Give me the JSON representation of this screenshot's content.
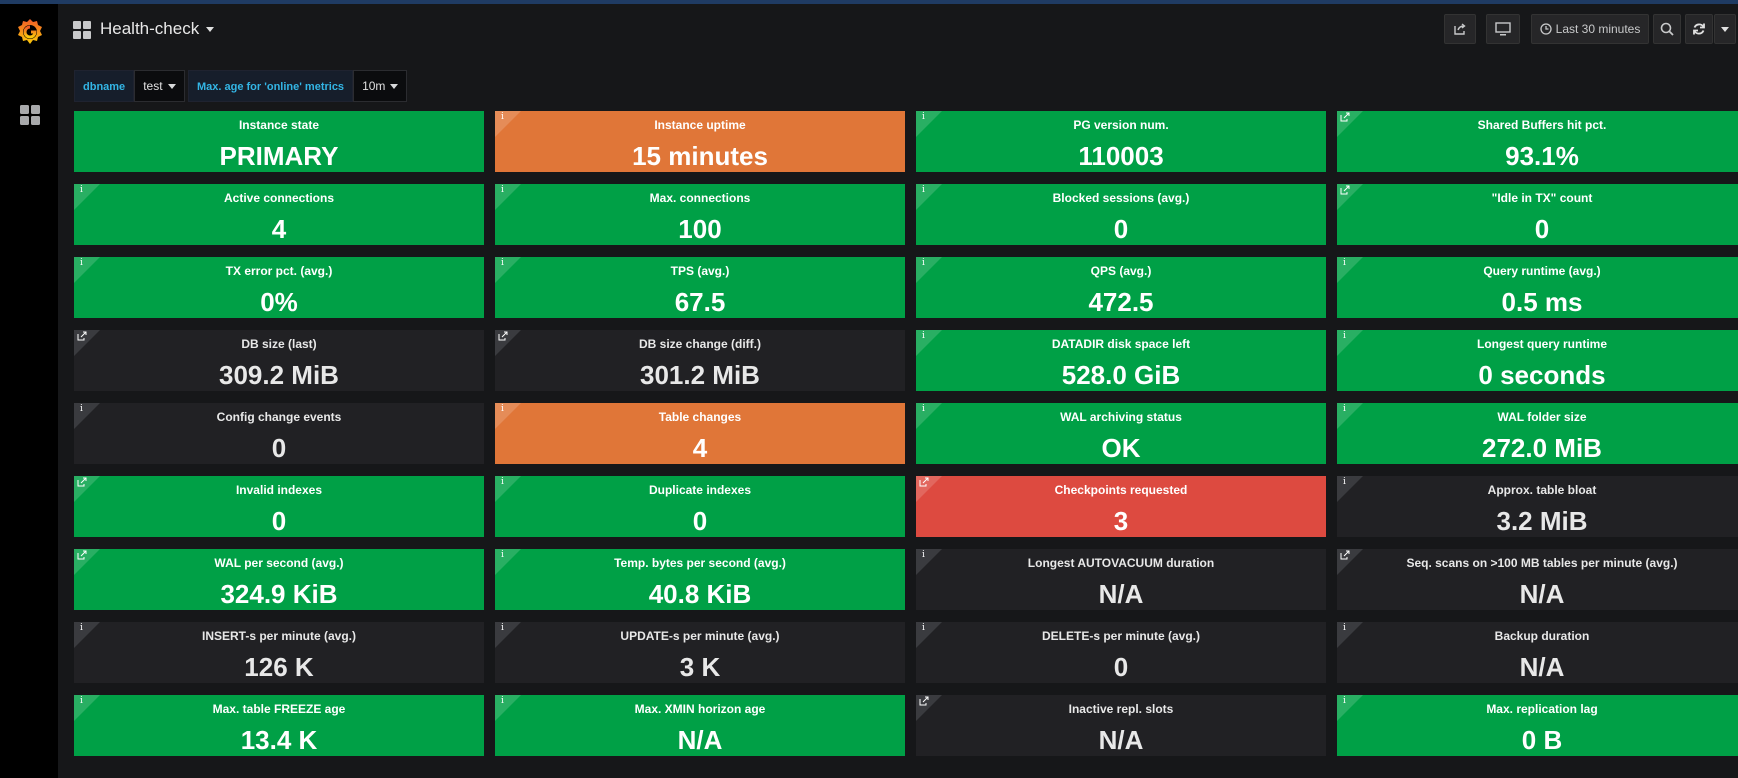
{
  "navbar": {
    "title": "Health-check",
    "time_range": "Last 30 minutes"
  },
  "variables": [
    {
      "label": "dbname",
      "value": "test"
    },
    {
      "label": "Max. age for 'online' metrics",
      "value": "10m"
    }
  ],
  "colors": {
    "ok": "#00a046",
    "warning": "#e07638",
    "critical": "#dd4a40",
    "neutral": "#212124"
  },
  "panels": [
    {
      "title": "Instance state",
      "value": "PRIMARY",
      "status": "green",
      "icon": "none"
    },
    {
      "title": "Instance uptime",
      "value": "15 minutes",
      "status": "orange",
      "icon": "info-icon"
    },
    {
      "title": "PG version num.",
      "value": "110003",
      "status": "green",
      "icon": "info-icon"
    },
    {
      "title": "Shared Buffers hit pct.",
      "value": "93.1%",
      "status": "green",
      "icon": "external-link-icon"
    },
    {
      "title": "Active connections",
      "value": "4",
      "status": "green",
      "icon": "info-icon"
    },
    {
      "title": "Max. connections",
      "value": "100",
      "status": "green",
      "icon": "info-icon"
    },
    {
      "title": "Blocked sessions (avg.)",
      "value": "0",
      "status": "green",
      "icon": "info-icon"
    },
    {
      "title": "\"Idle in TX\" count",
      "value": "0",
      "status": "green",
      "icon": "external-link-icon"
    },
    {
      "title": "TX error pct. (avg.)",
      "value": "0%",
      "status": "green",
      "icon": "info-icon"
    },
    {
      "title": "TPS (avg.)",
      "value": "67.5",
      "status": "green",
      "icon": "info-icon"
    },
    {
      "title": "QPS (avg.)",
      "value": "472.5",
      "status": "green",
      "icon": "info-icon"
    },
    {
      "title": "Query runtime (avg.)",
      "value": "0.5 ms",
      "status": "green",
      "icon": "info-icon"
    },
    {
      "title": "DB size (last)",
      "value": "309.2 MiB",
      "status": "dark",
      "icon": "external-link-icon"
    },
    {
      "title": "DB size change (diff.)",
      "value": "301.2 MiB",
      "status": "dark",
      "icon": "external-link-icon"
    },
    {
      "title": "DATADIR disk space left",
      "value": "528.0 GiB",
      "status": "green",
      "icon": "info-icon"
    },
    {
      "title": "Longest query runtime",
      "value": "0 seconds",
      "status": "green",
      "icon": "info-icon"
    },
    {
      "title": "Config change events",
      "value": "0",
      "status": "dark",
      "icon": "info-icon"
    },
    {
      "title": "Table changes",
      "value": "4",
      "status": "orange",
      "icon": "info-icon"
    },
    {
      "title": "WAL archiving status",
      "value": "OK",
      "status": "green",
      "icon": "info-icon"
    },
    {
      "title": "WAL folder size",
      "value": "272.0 MiB",
      "status": "green",
      "icon": "info-icon"
    },
    {
      "title": "Invalid indexes",
      "value": "0",
      "status": "green",
      "icon": "external-link-icon"
    },
    {
      "title": "Duplicate indexes",
      "value": "0",
      "status": "green",
      "icon": "info-icon"
    },
    {
      "title": "Checkpoints requested",
      "value": "3",
      "status": "red",
      "icon": "external-link-icon"
    },
    {
      "title": "Approx. table bloat",
      "value": "3.2 MiB",
      "status": "dark",
      "icon": "info-icon"
    },
    {
      "title": "WAL per second (avg.)",
      "value": "324.9 KiB",
      "status": "green",
      "icon": "external-link-icon"
    },
    {
      "title": "Temp. bytes per second (avg.)",
      "value": "40.8 KiB",
      "status": "green",
      "icon": "info-icon"
    },
    {
      "title": "Longest AUTOVACUUM duration",
      "value": "N/A",
      "status": "dark",
      "icon": "info-icon"
    },
    {
      "title": "Seq. scans on >100 MB tables per minute (avg.)",
      "value": "N/A",
      "status": "dark",
      "icon": "external-link-icon"
    },
    {
      "title": "INSERT-s per minute (avg.)",
      "value": "126 K",
      "status": "dark",
      "icon": "info-icon"
    },
    {
      "title": "UPDATE-s per minute (avg.)",
      "value": "3 K",
      "status": "dark",
      "icon": "info-icon"
    },
    {
      "title": "DELETE-s per minute (avg.)",
      "value": "0",
      "status": "dark",
      "icon": "info-icon"
    },
    {
      "title": "Backup duration",
      "value": "N/A",
      "status": "dark",
      "icon": "info-icon"
    },
    {
      "title": "Max. table FREEZE age",
      "value": "13.4 K",
      "status": "green",
      "icon": "info-icon"
    },
    {
      "title": "Max. XMIN horizon age",
      "value": "N/A",
      "status": "green",
      "icon": "info-icon"
    },
    {
      "title": "Inactive repl. slots",
      "value": "N/A",
      "status": "dark",
      "icon": "external-link-icon"
    },
    {
      "title": "Max. replication lag",
      "value": "0 B",
      "status": "green",
      "icon": "info-icon"
    }
  ]
}
